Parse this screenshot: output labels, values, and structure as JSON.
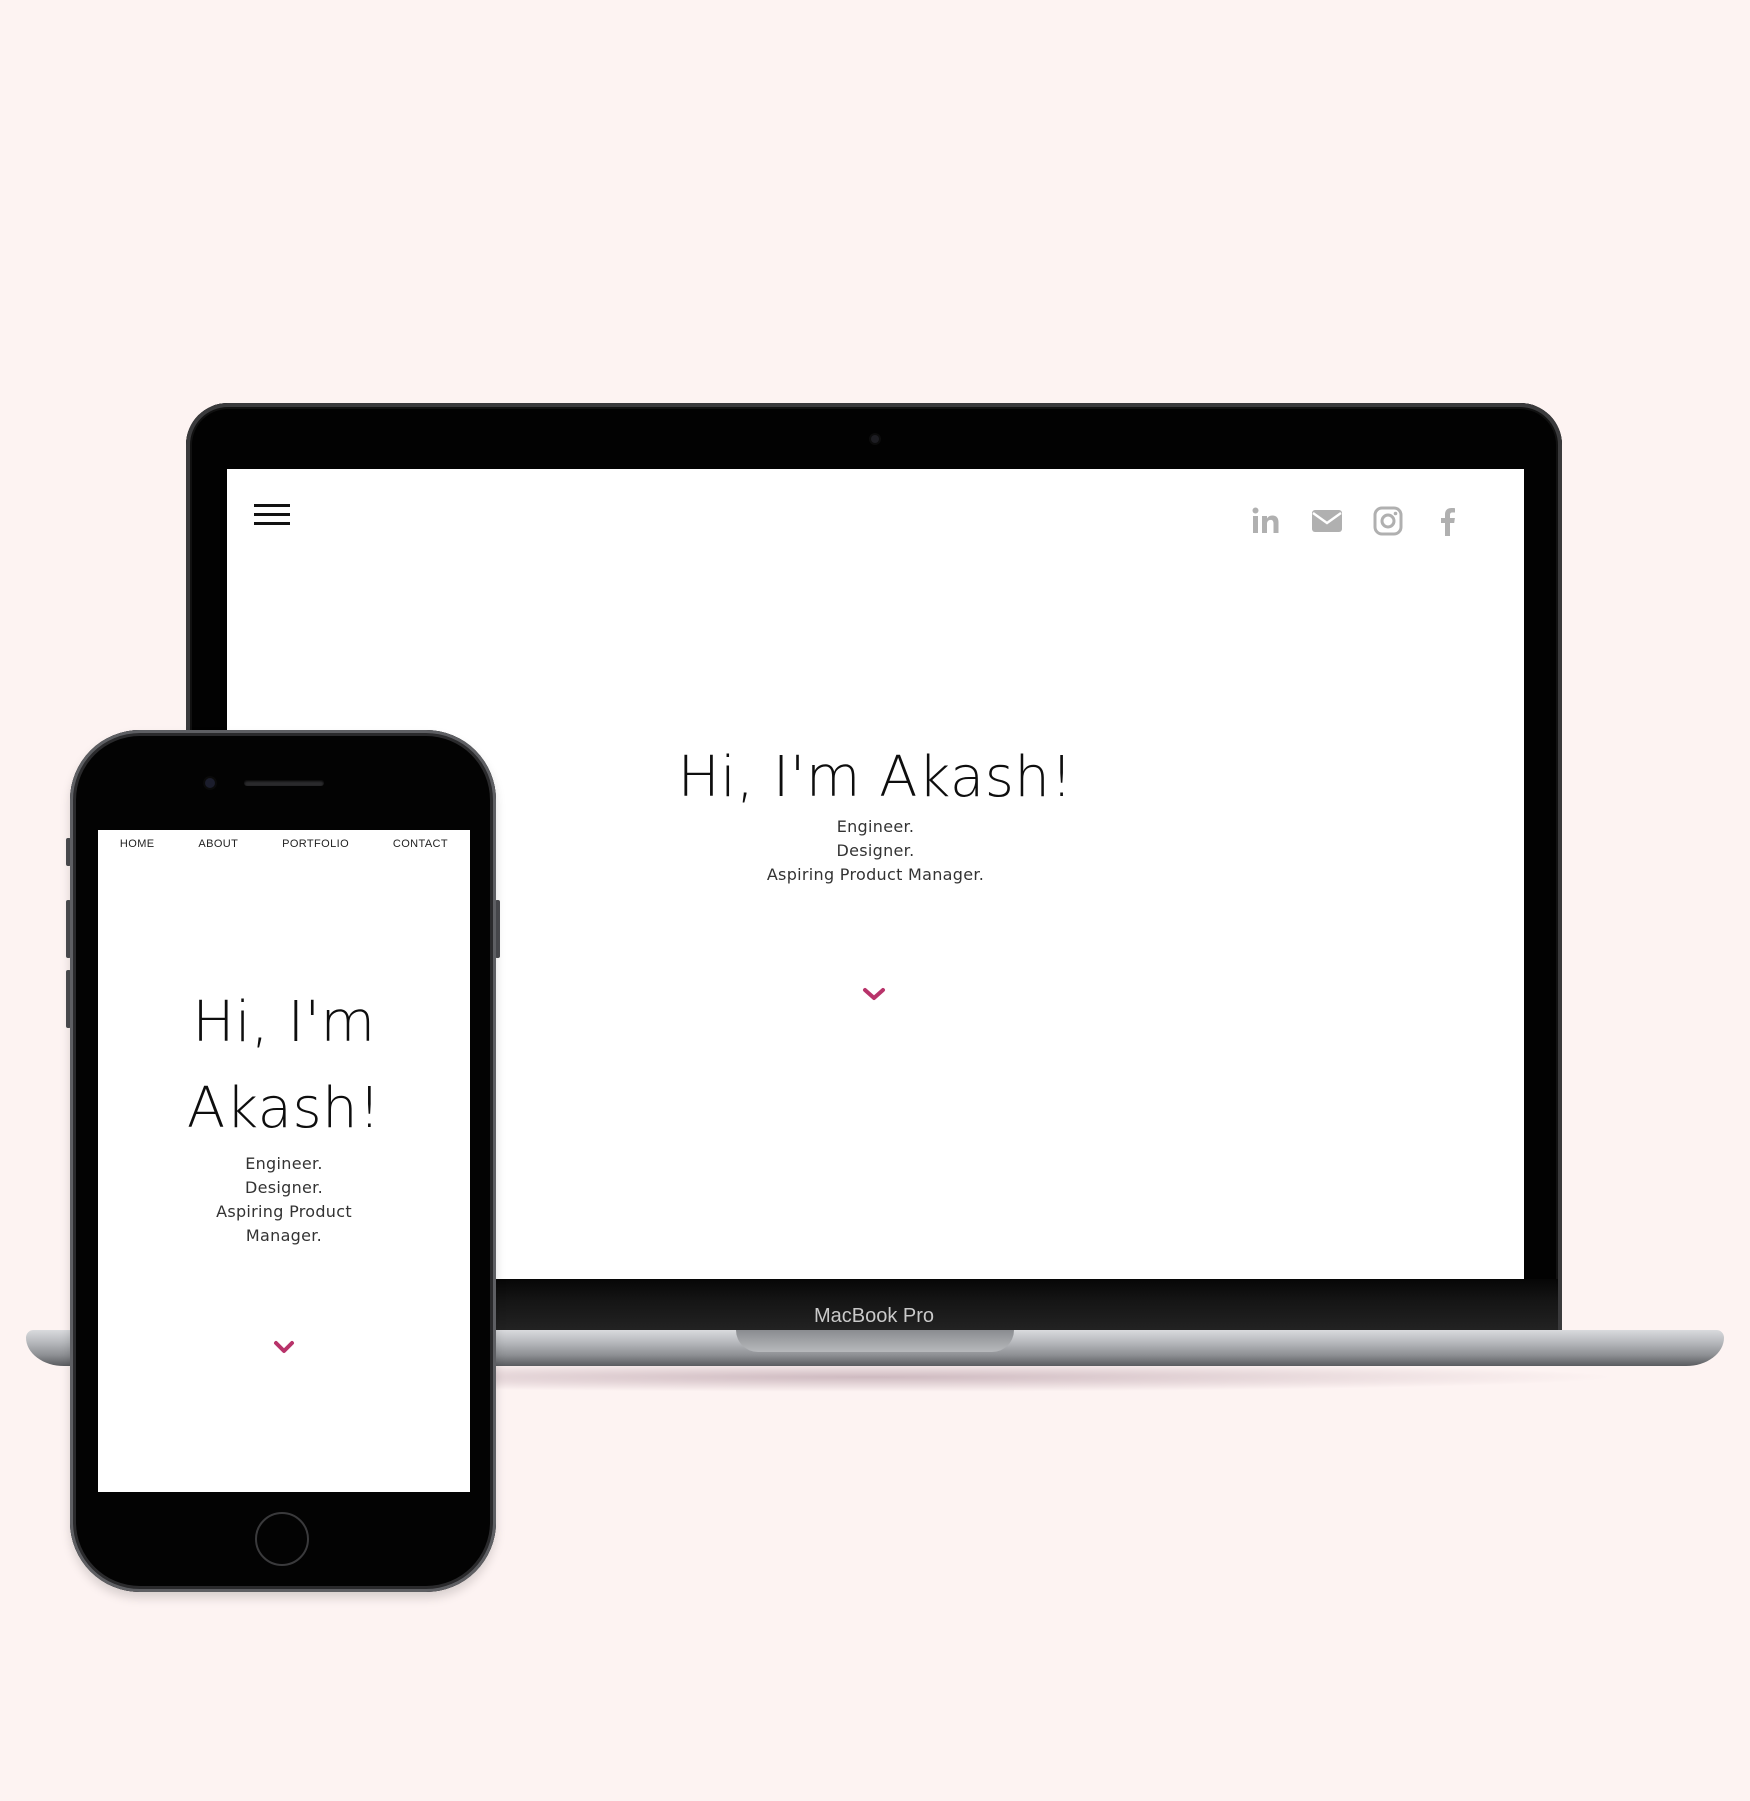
{
  "colors": {
    "background": "#fdf3f2",
    "accent": "#b8336a",
    "social_icon": "#b0b0b0",
    "text": "#0e0e0e"
  },
  "laptop": {
    "model_label": "MacBook Pro",
    "screen": {
      "menu_icon": "hamburger-menu-icon",
      "social_icons": [
        "linkedin-icon",
        "email-icon",
        "instagram-icon",
        "facebook-icon"
      ],
      "hero": {
        "title": "Hi, I'm Akash!",
        "lines": [
          "Engineer.",
          "Designer.",
          "Aspiring Product Manager."
        ]
      },
      "scroll_icon": "chevron-down-icon"
    }
  },
  "phone": {
    "screen": {
      "nav": [
        "HOME",
        "ABOUT",
        "PORTFOLIO",
        "CONTACT"
      ],
      "hero": {
        "title_line1": "Hi, I'm",
        "title_line2": "Akash!",
        "lines": [
          "Engineer.",
          "Designer.",
          "Aspiring Product",
          "Manager."
        ]
      },
      "scroll_icon": "chevron-down-icon"
    }
  }
}
